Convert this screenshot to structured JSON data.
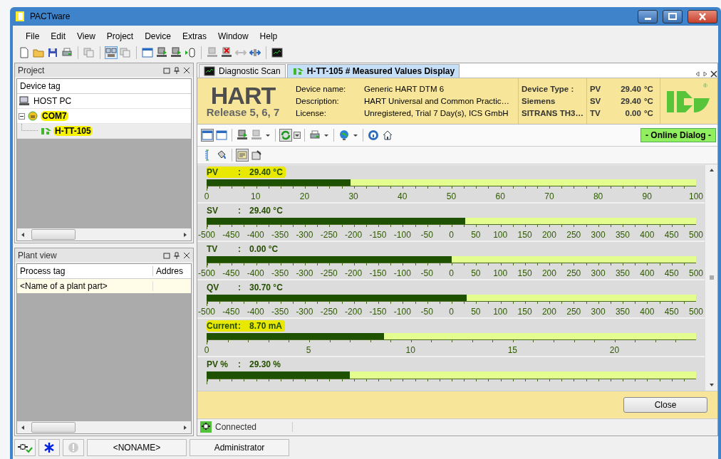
{
  "window": {
    "title": "PACTware"
  },
  "menu": [
    "File",
    "Edit",
    "View",
    "Project",
    "Device",
    "Extras",
    "Window",
    "Help"
  ],
  "project_panel": {
    "title": "Project",
    "column": "Device tag",
    "tree": [
      {
        "label": "HOST PC",
        "kind": "pc",
        "highlighted": false,
        "selected": false
      },
      {
        "label": "COM7",
        "kind": "port",
        "highlighted": true,
        "selected": false,
        "expanded": true,
        "children": [
          {
            "label": "H-TT-105",
            "kind": "device",
            "highlighted": true,
            "selected": true
          }
        ]
      }
    ]
  },
  "plant_panel": {
    "title": "Plant view",
    "columns": [
      "Process tag",
      "Addres"
    ],
    "rows": [
      [
        "<Name of a plant part>"
      ]
    ]
  },
  "tabs": [
    {
      "label": "Diagnostic Scan",
      "kind": "scan",
      "selected": false
    },
    {
      "label": "H-TT-105 # Measured Values Display",
      "kind": "device",
      "selected": true
    }
  ],
  "device_header": {
    "logo_title": "HART",
    "logo_subtitle": "Release 5, 6, 7",
    "registered_mark": "®",
    "fields": [
      {
        "label": "Device name:",
        "value": "Generic HART DTM 6"
      },
      {
        "label": "Description:",
        "value": "HART Universal and Common Practic…"
      },
      {
        "label": "License:",
        "value": "Unregistered, Trial 7 Day(s), ICS GmbH"
      }
    ],
    "vendor": [
      "Device Type :",
      "Siemens",
      "SITRANS TH3…"
    ],
    "variables": [
      {
        "name": "PV",
        "value": "29.40",
        "unit": "°C"
      },
      {
        "name": "SV",
        "value": "29.40",
        "unit": "°C"
      },
      {
        "name": "TV",
        "value": "0.00",
        "unit": "°C"
      }
    ]
  },
  "online_status": "- Online Dialog -",
  "gauges": [
    {
      "label": "PV",
      "separator": ":",
      "reading": "29.40 °C",
      "highlighted": true,
      "level": 0.294,
      "kind": "full",
      "ticks": [
        "0",
        "10",
        "20",
        "30",
        "40",
        "50",
        "60",
        "70",
        "80",
        "90",
        "100"
      ]
    },
    {
      "label": "SV",
      "separator": ":",
      "reading": "29.40 °C",
      "highlighted": false,
      "level": 0.529,
      "kind": "full",
      "ticks": [
        "-500",
        "-450",
        "-400",
        "-350",
        "-300",
        "-250",
        "-200",
        "-150",
        "-100",
        "-50",
        "0",
        "50",
        "100",
        "150",
        "200",
        "250",
        "300",
        "350",
        "400",
        "450",
        "500"
      ]
    },
    {
      "label": "TV",
      "separator": ":",
      "reading": "0.00 °C",
      "highlighted": false,
      "level": 0.5,
      "kind": "full",
      "ticks": [
        "-500",
        "-450",
        "-400",
        "-350",
        "-300",
        "-250",
        "-200",
        "-150",
        "-100",
        "-50",
        "0",
        "50",
        "100",
        "150",
        "200",
        "250",
        "300",
        "350",
        "400",
        "450",
        "500"
      ]
    },
    {
      "label": "QV",
      "separator": ":",
      "reading": "30.70 °C",
      "highlighted": false,
      "level": 0.531,
      "kind": "full",
      "ticks": [
        "-500",
        "-450",
        "-400",
        "-350",
        "-300",
        "-250",
        "-200",
        "-150",
        "-100",
        "-50",
        "0",
        "50",
        "100",
        "150",
        "200",
        "250",
        "300",
        "350",
        "400",
        "450",
        "500"
      ]
    },
    {
      "label": "Current",
      "separator": ":",
      "reading": "8.70 mA",
      "highlighted": true,
      "level": 0.362,
      "kind": "partial",
      "ticks": [
        "0",
        "5",
        "10",
        "15",
        "20"
      ]
    },
    {
      "label": "PV %",
      "separator": ":",
      "reading": "29.30 %",
      "highlighted": false,
      "level": 0.292,
      "kind": "full"
    }
  ],
  "footer": {
    "close_button": "Close"
  },
  "status": {
    "text": "Connected"
  },
  "bottom_bar": {
    "project": "<NONAME>",
    "user": "Administrator"
  }
}
